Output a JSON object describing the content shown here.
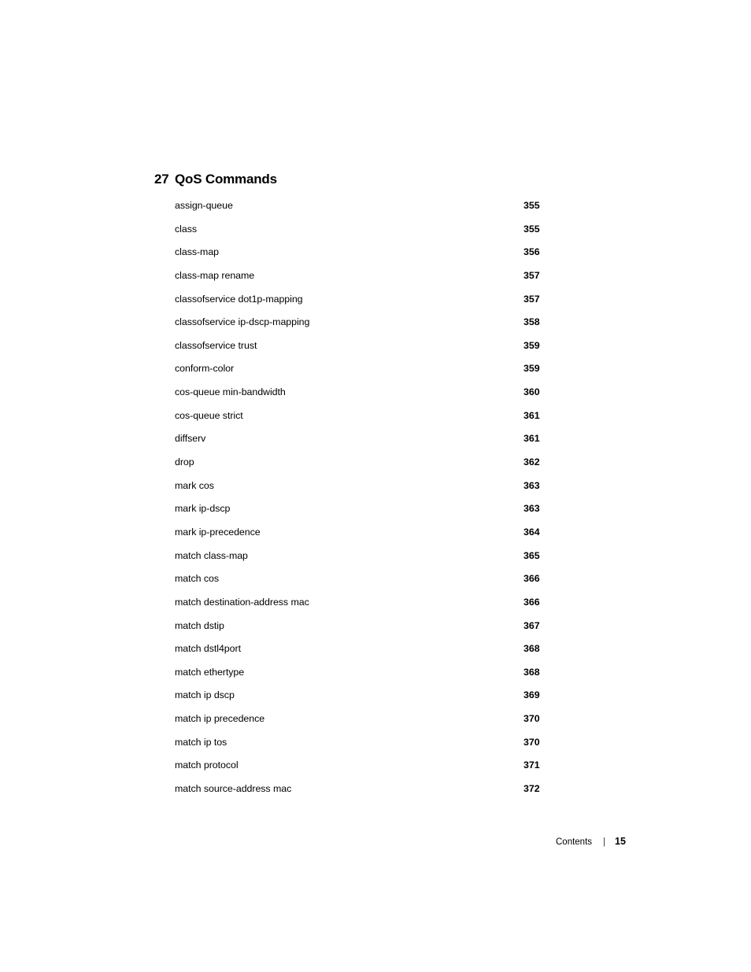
{
  "document": {
    "type": "table-of-contents",
    "background_color": "#ffffff",
    "text_color": "#000000"
  },
  "chapter": {
    "number": "27",
    "title": "QoS Commands"
  },
  "toc": {
    "entries": [
      {
        "label": "assign-queue",
        "page": "355"
      },
      {
        "label": "class",
        "page": "355"
      },
      {
        "label": "class-map",
        "page": "356"
      },
      {
        "label": "class-map rename",
        "page": "357"
      },
      {
        "label": "classofservice dot1p-mapping",
        "page": "357"
      },
      {
        "label": "classofservice ip-dscp-mapping",
        "page": "358"
      },
      {
        "label": "classofservice trust",
        "page": "359"
      },
      {
        "label": "conform-color",
        "page": "359"
      },
      {
        "label": "cos-queue min-bandwidth",
        "page": "360"
      },
      {
        "label": "cos-queue strict",
        "page": "361"
      },
      {
        "label": "diffserv",
        "page": "361"
      },
      {
        "label": "drop",
        "page": "362"
      },
      {
        "label": "mark cos",
        "page": "363"
      },
      {
        "label": "mark ip-dscp",
        "page": "363"
      },
      {
        "label": "mark ip-precedence",
        "page": "364"
      },
      {
        "label": "match class-map",
        "page": "365"
      },
      {
        "label": "match cos",
        "page": "366"
      },
      {
        "label": "match destination-address mac",
        "page": "366"
      },
      {
        "label": "match dstip",
        "page": "367"
      },
      {
        "label": "match dstl4port",
        "page": "368"
      },
      {
        "label": "match ethertype",
        "page": "368"
      },
      {
        "label": "match ip dscp",
        "page": "369"
      },
      {
        "label": "match ip precedence",
        "page": "370"
      },
      {
        "label": "match ip tos",
        "page": "370"
      },
      {
        "label": "match protocol",
        "page": "371"
      },
      {
        "label": "match source-address mac",
        "page": "372"
      }
    ]
  },
  "footer": {
    "label": "Contents",
    "separator": "|",
    "page_number": "15"
  }
}
